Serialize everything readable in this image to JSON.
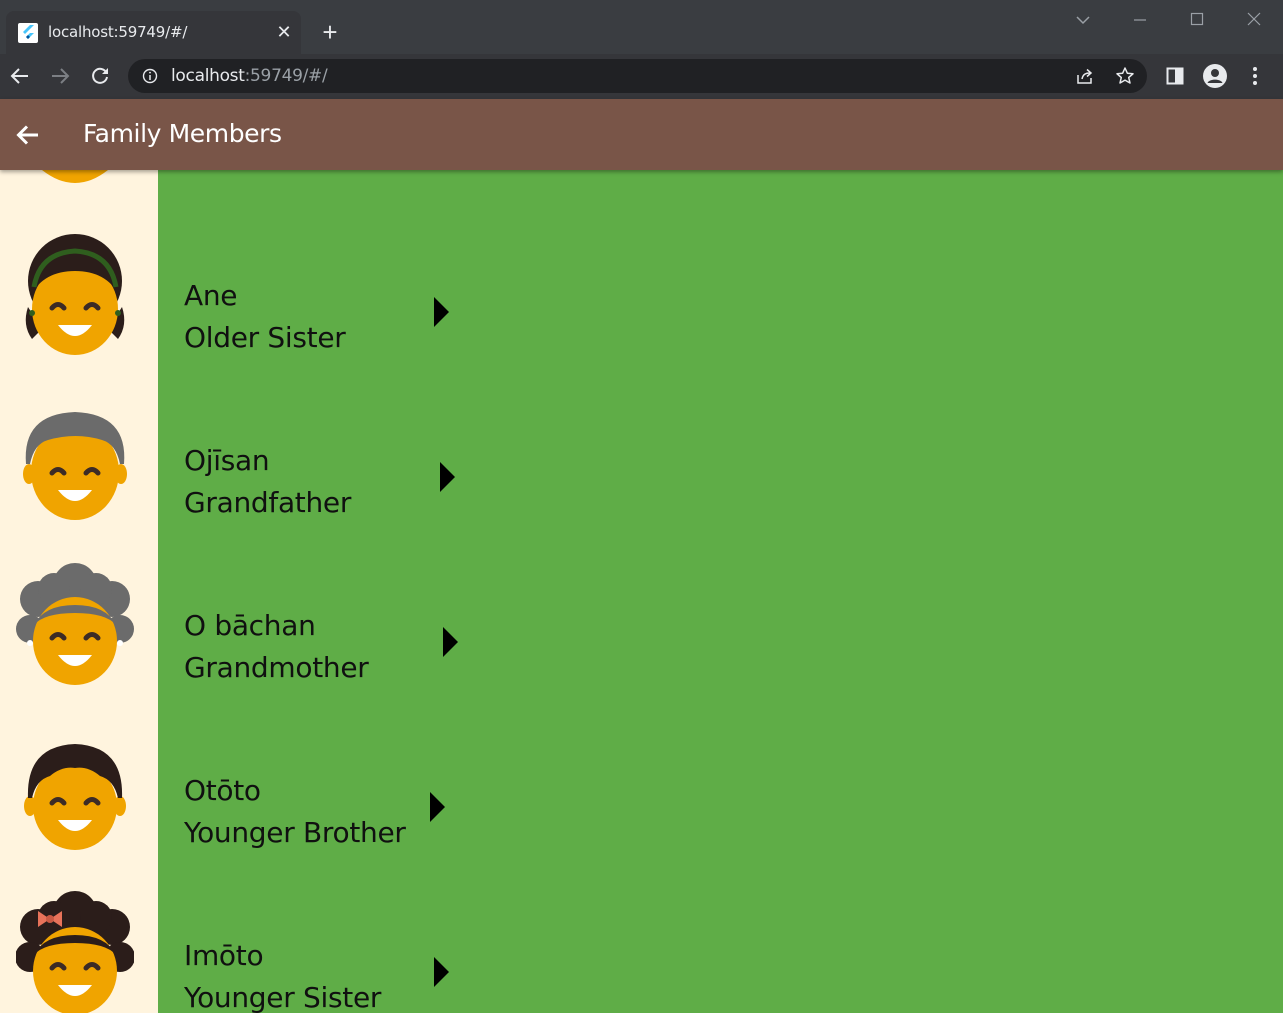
{
  "browser": {
    "tab_title": "localhost:59749/#/",
    "url_host": "localhost",
    "url_rest": ":59749/#/"
  },
  "appbar": {
    "title": "Family Members"
  },
  "members": [
    {
      "japanese": "Ane",
      "english": "Older Sister",
      "avatar": "older-sister-avatar"
    },
    {
      "japanese": "Ojīsan",
      "english": "Grandfather",
      "avatar": "grandfather-avatar"
    },
    {
      "japanese": "O bāchan",
      "english": "Grandmother",
      "avatar": "grandmother-avatar"
    },
    {
      "japanese": "Otōto",
      "english": "Younger Brother",
      "avatar": "younger-brother-avatar"
    },
    {
      "japanese": "Imōto",
      "english": "Younger Sister",
      "avatar": "younger-sister-avatar"
    }
  ],
  "colors": {
    "appbar": "#795548",
    "list_background": "#5fad47",
    "avatar_background": "#fff4de",
    "skin": "#f0a400"
  }
}
